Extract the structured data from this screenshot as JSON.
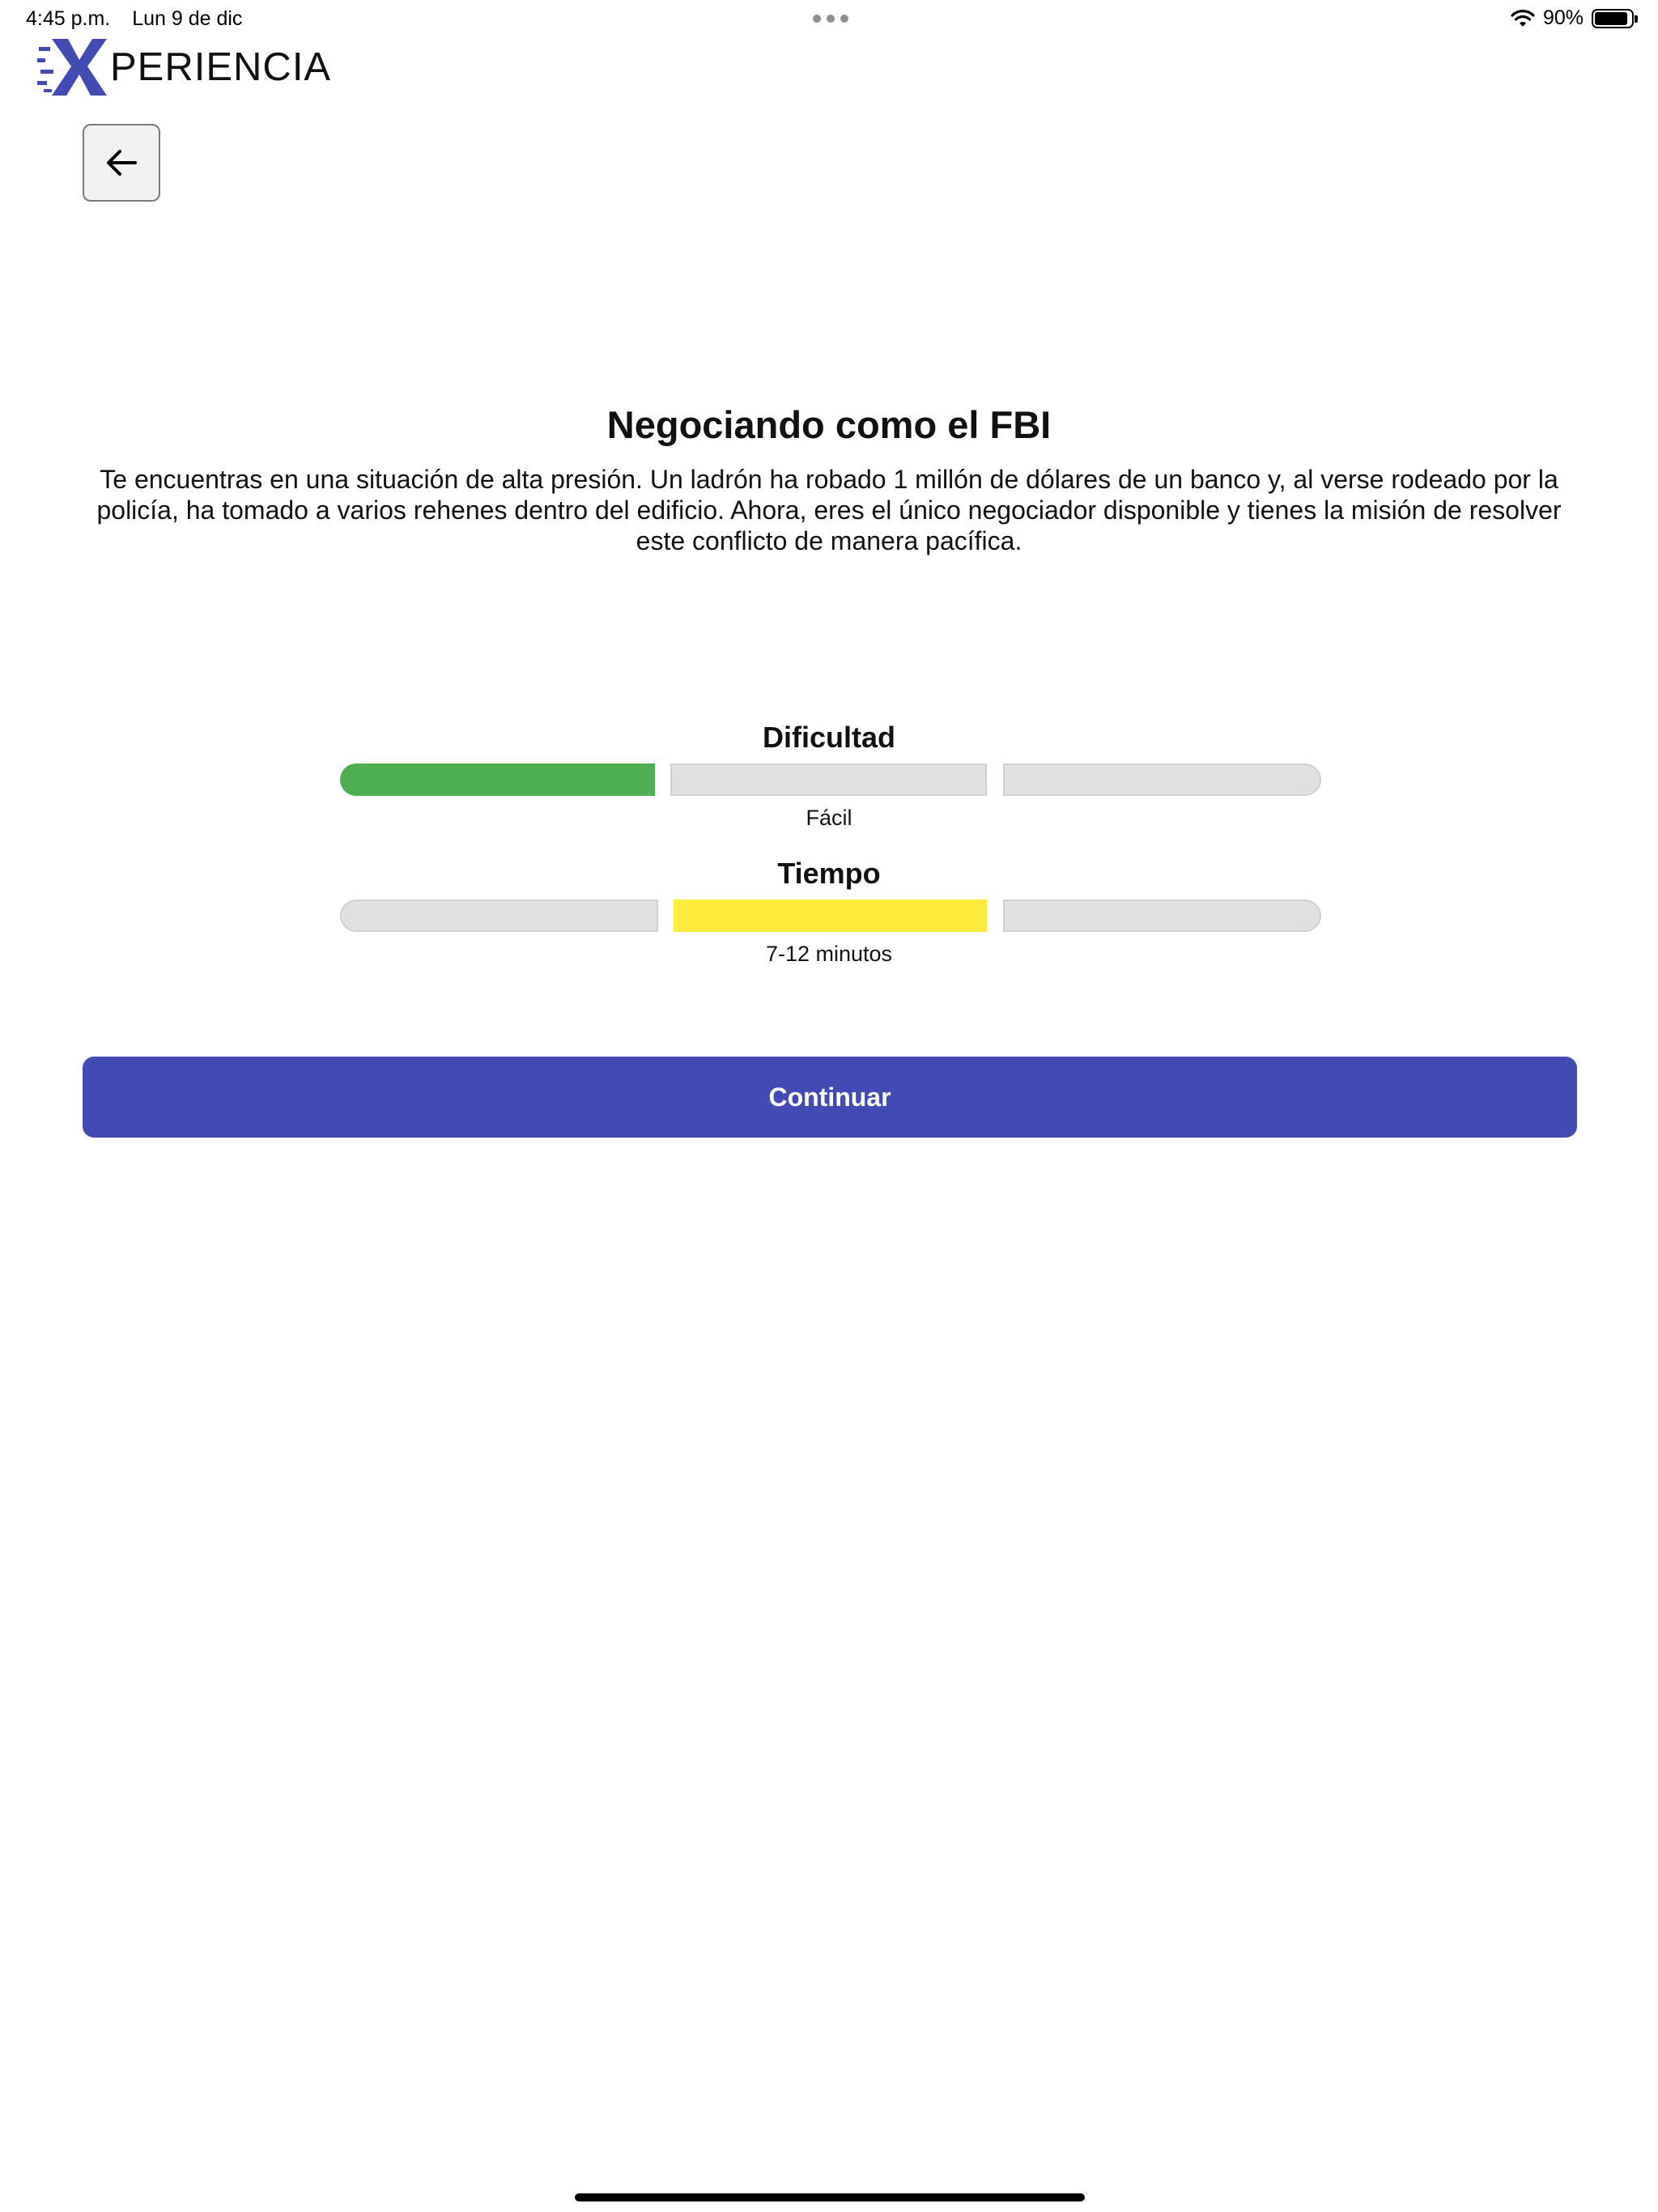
{
  "status_bar": {
    "time": "4:45 p.m.",
    "date": "Lun 9 de dic",
    "battery_text": "90%",
    "battery_level": 0.9,
    "icons": [
      "multitasking-dots-icon",
      "wifi-icon",
      "battery-icon"
    ]
  },
  "brand": {
    "logo_text": "PERIENCIA",
    "logo_letter": "X",
    "accent_color": "#424bb3"
  },
  "header": {
    "back_icon": "arrow-left-icon"
  },
  "experience": {
    "title": "Negociando como el FBI",
    "description": "Te encuentras en una situación de alta presión. Un ladrón ha robado 1 millón de dólares de un banco y, al verse rodeado por la policía, ha tomado a varios rehenes dentro del edificio. Ahora, eres el único negociador disponible y tienes la misión de resolver este conflicto de manera pacífica."
  },
  "difficulty": {
    "label": "Dificultad",
    "value_label": "Fácil",
    "segments": 3,
    "active_segment": 1,
    "active_color": "#4caf50"
  },
  "time": {
    "label": "Tiempo",
    "value_label": "7-12 minutos",
    "segments": 3,
    "active_segment": 2,
    "active_color": "#ffeb3b"
  },
  "actions": {
    "continue_label": "Continuar"
  }
}
